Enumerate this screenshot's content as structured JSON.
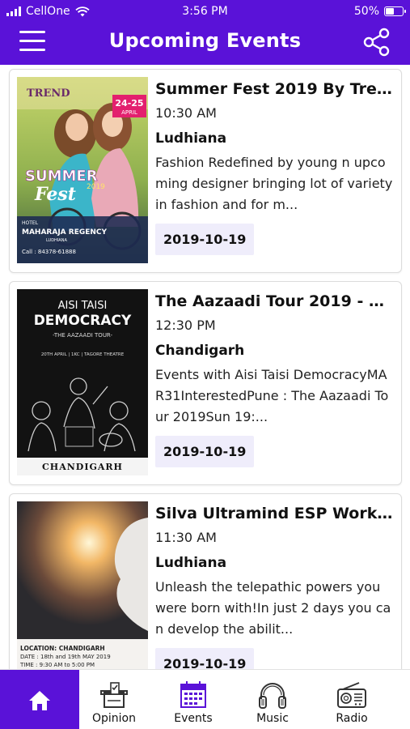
{
  "status_bar": {
    "carrier": "CellOne",
    "time": "3:56 PM",
    "battery_percent": "50%",
    "battery_level": 0.5
  },
  "header": {
    "title": "Upcoming Events",
    "menu_icon": "hamburger-menu-icon",
    "share_icon": "share-icon",
    "background_color": "#5a12d8"
  },
  "events": [
    {
      "title": "Summer Fest 2019 By Tren...",
      "time": "10:30 AM",
      "city": "Ludhiana",
      "description": "Fashion Redefined by young n upcoming designer bringing lot of variety in fashion and for m...",
      "date": "2019-10-19",
      "poster": {
        "brand": "TREND",
        "dates": "24-25",
        "month": "APRIL",
        "headline": "SUMMER",
        "headline2": "Fest",
        "year": "2019",
        "venue_label": "HOTEL",
        "venue": "MAHARAJA REGENCY",
        "venue_city": "LUDHIANA",
        "phone": "Call : 84378-61888"
      }
    },
    {
      "title": "The Aazaadi Tour 2019 - Ch...",
      "time": "12:30 PM",
      "city": "Chandigarh",
      "description": "Events with Aisi Taisi DemocracyMAR31InterestedPune : The Aazaadi Tour 2019Sun 19:...",
      "date": "2019-10-19",
      "poster": {
        "line1": "AISI TAISI",
        "line2": "DEMOCRACY",
        "line3": "-THE AAZAADI TOUR-",
        "details": "20TH APRIL | 1KC | TAGORE THEATRE",
        "footer": "CHANDIGARH"
      }
    },
    {
      "title": "Silva Ultramind ESP Works...",
      "time": "11:30 AM",
      "city": "Ludhiana",
      "description": "Unleash the telepathic powers you were born with!In just 2 days you can develop the abilit...",
      "date": "2019-10-19",
      "poster": {
        "location": "LOCATION: CHANDIGARH",
        "date_line": "DATE : 18th and 19th MAY 2019",
        "time_line": "TIME : 9:30 AM to 5:00 PM"
      }
    }
  ],
  "tabbar": {
    "active_color": "#5a12d8",
    "items": [
      {
        "label": "",
        "icon": "home-icon",
        "active": true
      },
      {
        "label": "Opinion",
        "icon": "ballot-box-icon",
        "active": false
      },
      {
        "label": "Events",
        "icon": "calendar-icon",
        "active": false
      },
      {
        "label": "Music",
        "icon": "headphones-icon",
        "active": false
      },
      {
        "label": "Radio",
        "icon": "radio-icon",
        "active": false
      }
    ]
  }
}
